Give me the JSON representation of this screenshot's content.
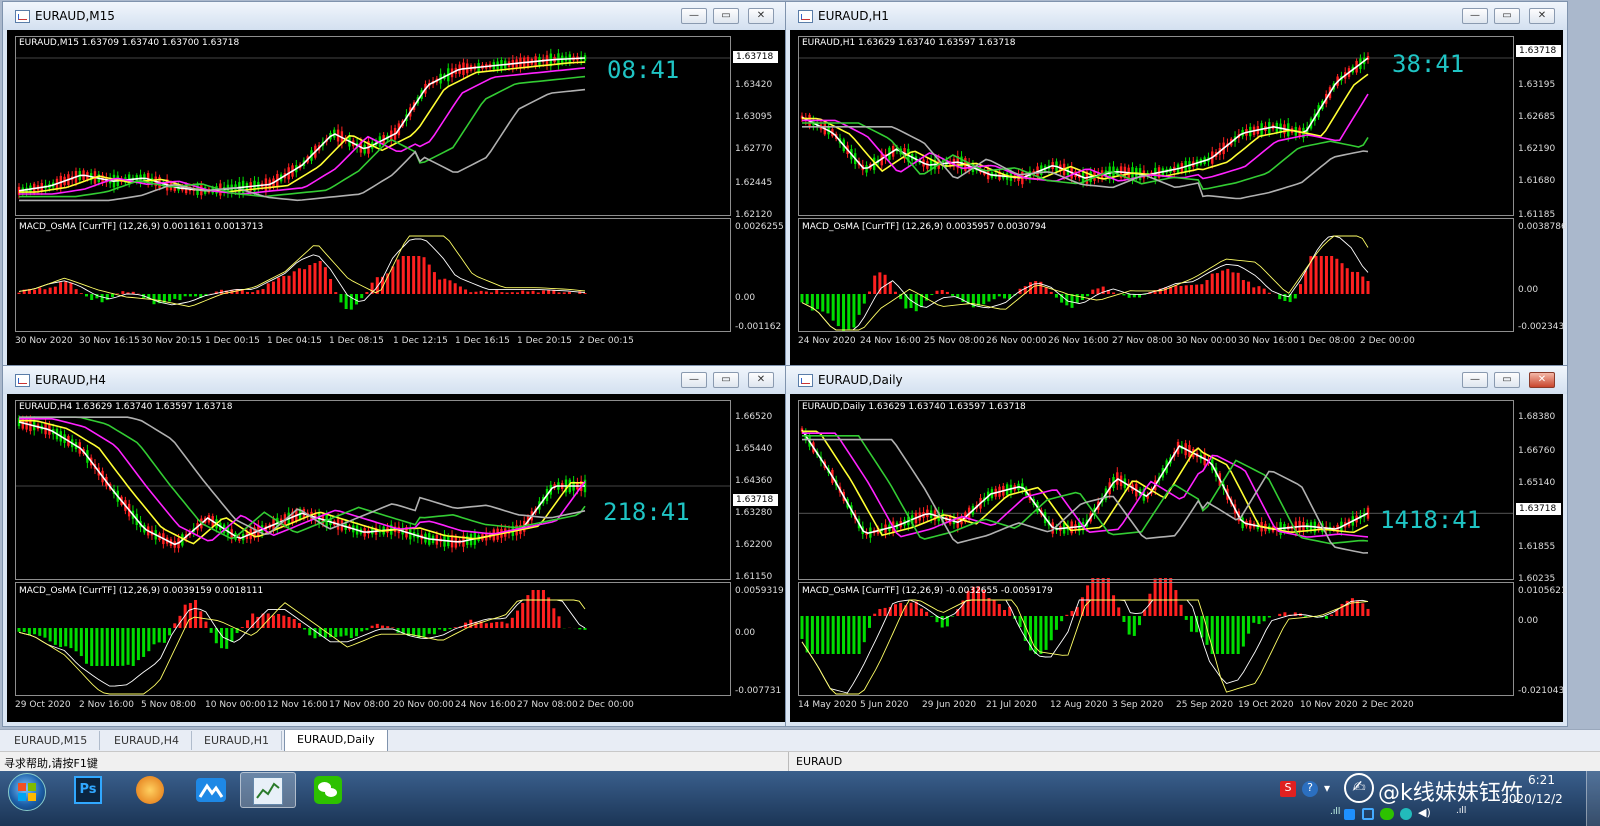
{
  "windows": [
    {
      "title": "EURAUD,M15",
      "ohlc": "EURAUD,M15  1.63709 1.63740 1.63700 1.63718",
      "timer": "08:41",
      "last_price": "1.63718",
      "price_ticks": [
        "1.63718",
        "1.63420",
        "1.63095",
        "1.62770",
        "1.62445",
        "1.62120"
      ],
      "indicator": "MACD_OsMA [CurrTF] (12,26,9) 0.0011611 0.0013713",
      "ind_ticks": [
        "0.0026255",
        "0.00",
        "-0.001162"
      ],
      "time_ticks": [
        "30 Nov 2020",
        "30 Nov 16:15",
        "30 Nov 20:15",
        "1 Dec 00:15",
        "1 Dec 04:15",
        "1 Dec 08:15",
        "1 Dec 12:15",
        "1 Dec 16:15",
        "1 Dec 20:15",
        "2 Dec 00:15"
      ]
    },
    {
      "title": "EURAUD,H1",
      "ohlc": "EURAUD,H1  1.63629 1.63740 1.63597 1.63718",
      "timer": "38:41",
      "last_price": "1.63718",
      "price_ticks": [
        "1.63718",
        "1.63195",
        "1.62685",
        "1.62190",
        "1.61680",
        "1.61185"
      ],
      "indicator": "MACD_OsMA [CurrTF] (12,26,9) 0.0035957 0.0030794",
      "ind_ticks": [
        "0.0038786",
        "0.00",
        "-0.002343"
      ],
      "time_ticks": [
        "24 Nov 2020",
        "24 Nov 16:00",
        "25 Nov 08:00",
        "26 Nov 00:00",
        "26 Nov 16:00",
        "27 Nov 08:00",
        "30 Nov 00:00",
        "30 Nov 16:00",
        "1 Dec 08:00",
        "2 Dec 00:00"
      ]
    },
    {
      "title": "EURAUD,H4",
      "ohlc": "EURAUD,H4  1.63629 1.63740 1.63597 1.63718",
      "timer": "218:41",
      "last_price": "1.63718",
      "price_ticks": [
        "1.66520",
        "1.65440",
        "1.64360",
        "1.63718",
        "1.63280",
        "1.62200",
        "1.61150"
      ],
      "indicator": "MACD_OsMA [CurrTF] (12,26,9) 0.0039159 0.0018111",
      "ind_ticks": [
        "0.0059319",
        "0.00",
        "-0.007731"
      ],
      "time_ticks": [
        "29 Oct 2020",
        "2 Nov 16:00",
        "5 Nov 08:00",
        "10 Nov 00:00",
        "12 Nov 16:00",
        "17 Nov 08:00",
        "20 Nov 00:00",
        "24 Nov 16:00",
        "27 Nov 08:00",
        "2 Dec 00:00"
      ]
    },
    {
      "title": "EURAUD,Daily",
      "ohlc": "EURAUD,Daily  1.63629 1.63740 1.63597 1.63718",
      "timer": "1418:41",
      "last_price": "1.63718",
      "price_ticks": [
        "1.68380",
        "1.66760",
        "1.65140",
        "1.63718",
        "1.61855",
        "1.60235"
      ],
      "indicator": "MACD_OsMA [CurrTF] (12,26,9) -0.0032655 -0.0059179",
      "ind_ticks": [
        "0.0105621",
        "0.00",
        "-0.021043"
      ],
      "time_ticks": [
        "14 May 2020",
        "5 Jun 2020",
        "29 Jun 2020",
        "21 Jul 2020",
        "12 Aug 2020",
        "3 Sep 2020",
        "25 Sep 2020",
        "19 Oct 2020",
        "10 Nov 2020",
        "2 Dec 2020"
      ]
    }
  ],
  "window_buttons": {
    "minimize": "—",
    "restore": "▭",
    "close": "✕"
  },
  "tabs": [
    "EURAUD,M15",
    "EURAUD,H4",
    "EURAUD,H1",
    "EURAUD,Daily"
  ],
  "active_tab": "EURAUD,Daily",
  "status": {
    "help": "寻求帮助,请按F1键",
    "symbol": "EURAUD"
  },
  "taskbar": {
    "apps": [
      "start-orb",
      "photoshop",
      "foxmail",
      "lanhu",
      "metatrader",
      "wechat"
    ],
    "watermark": "@k线妹妹钰竹",
    "time": "6:21",
    "date": "2020/12/2"
  },
  "colors": {
    "bull": "#00dd00",
    "bear": "#ff2020",
    "timer": "#1fc4c4",
    "ma_white": "#ffffff",
    "ma_yellow": "#ffff33",
    "ma_magenta": "#ff22ff",
    "ma_green": "#33cc33",
    "ma_gray": "#b0b0b0"
  }
}
